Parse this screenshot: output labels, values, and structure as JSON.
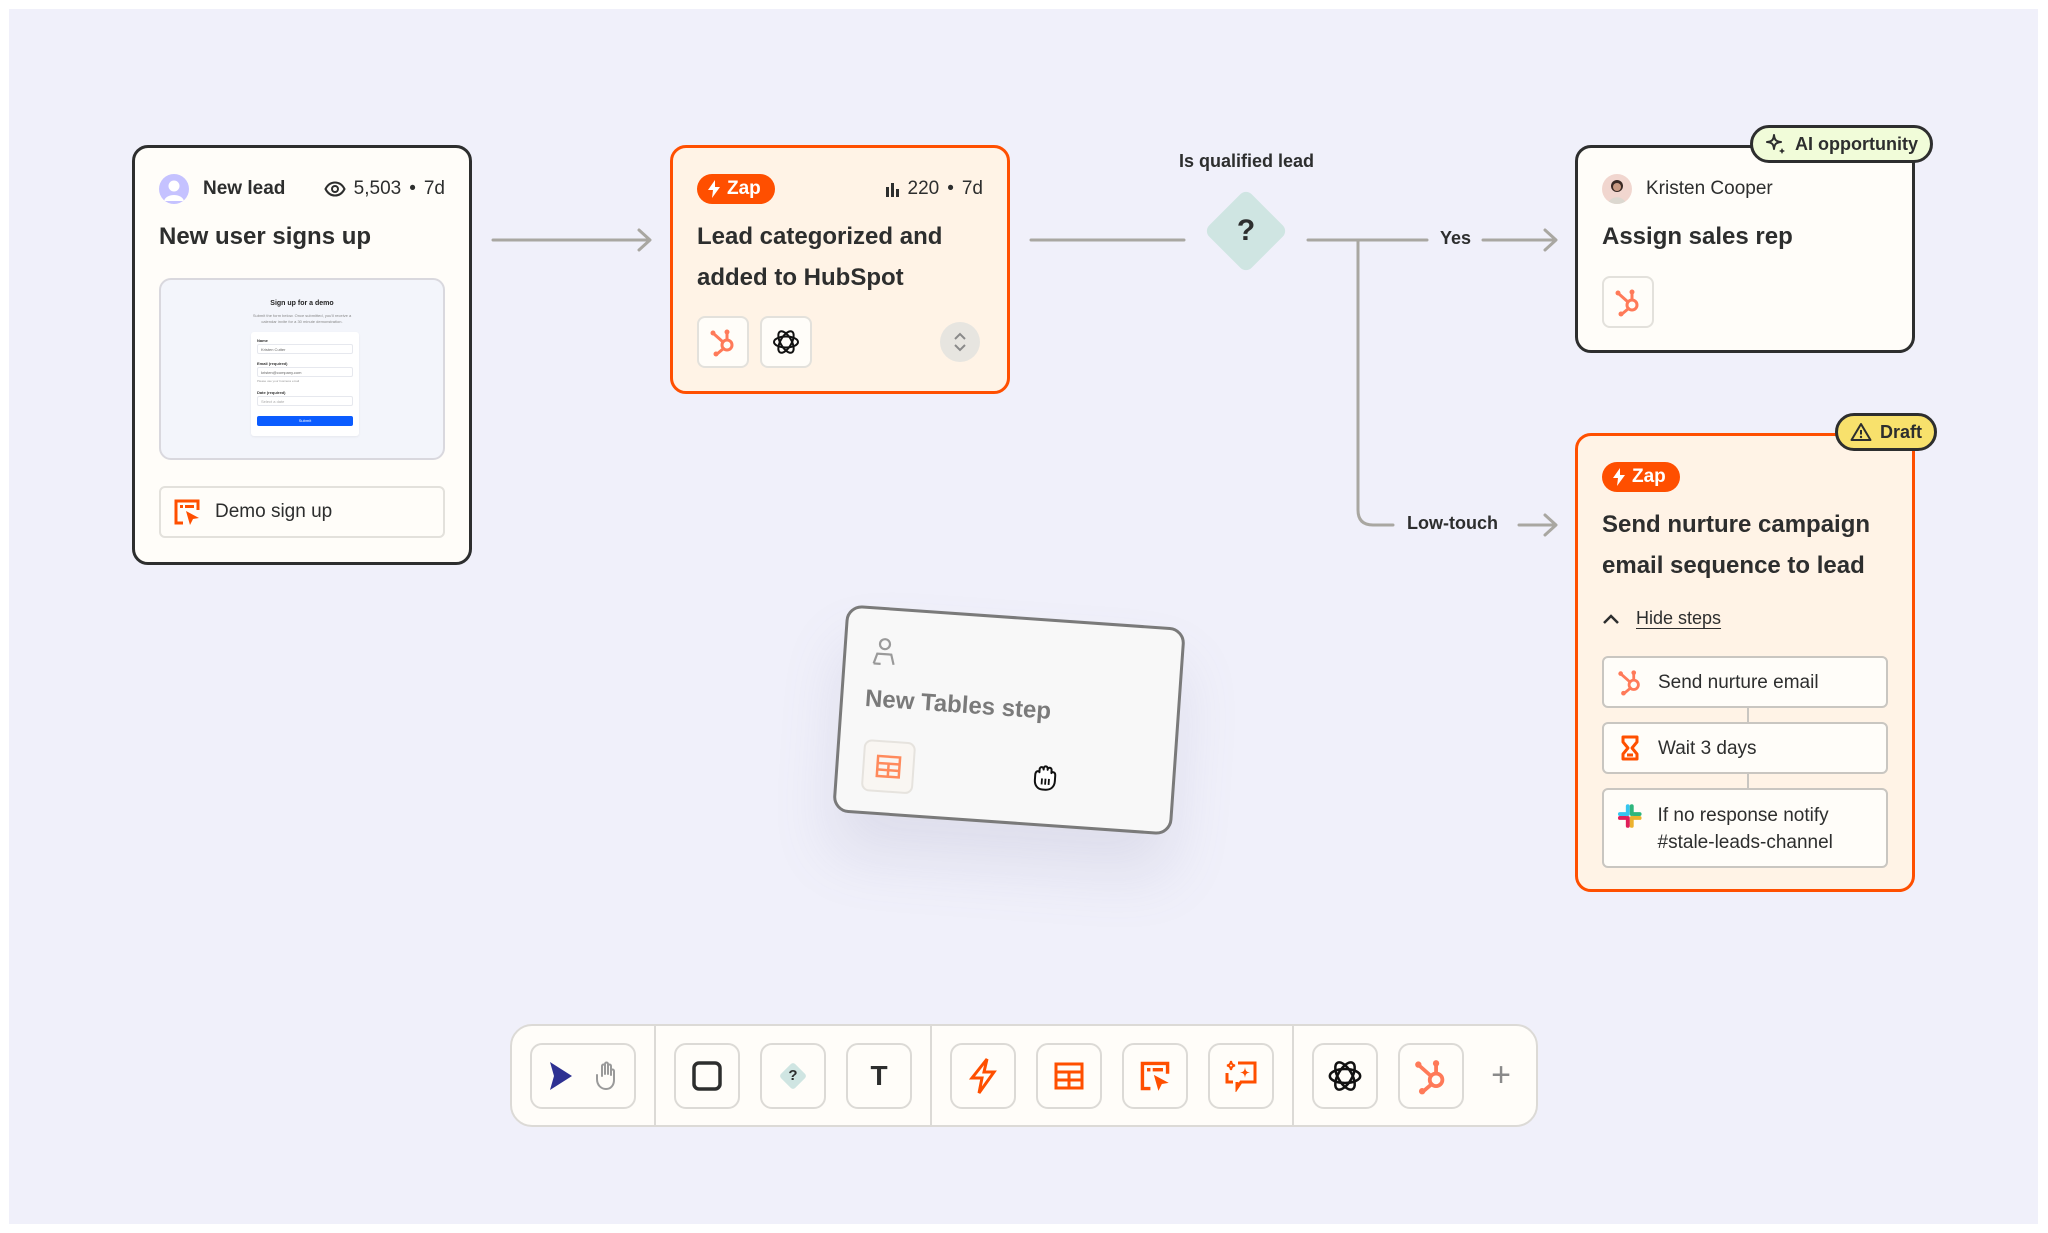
{
  "canvas": {
    "background": "#f0f0fa",
    "accent": "#ff4f00",
    "edge_color": "#a9a7a1"
  },
  "nodes": {
    "trigger": {
      "kind_label": "New lead",
      "views": "5,503",
      "period": "7d",
      "meta_separator": "•",
      "title": "New user signs up",
      "preview": {
        "heading": "Sign up for a demo",
        "subtext": "Submit the form below. Once submitted, you'll receive a calendar invite for a 30 minute demonstration.",
        "fields": [
          {
            "label": "Name",
            "value": "Kristen Cutter"
          },
          {
            "label": "Email (required)",
            "value": "kristen@company.com",
            "hint": "Please use your business email"
          },
          {
            "label": "Date (required)",
            "value": "Select a date"
          }
        ],
        "submit_label": "Submit"
      },
      "source_label": "Demo sign up"
    },
    "zap1": {
      "pill_label": "Zap",
      "runs": "220",
      "period": "7d",
      "meta_separator": "•",
      "title": "Lead categorized and added to HubSpot",
      "apps": [
        "hubspot-icon",
        "openai-icon"
      ]
    },
    "decision": {
      "label": "Is qualified lead",
      "glyph": "?",
      "branches": [
        "Yes",
        "Low-touch"
      ]
    },
    "assign": {
      "badge_label": "AI opportunity",
      "owner": "Kristen Cooper",
      "title": "Assign sales rep",
      "apps": [
        "hubspot-icon"
      ]
    },
    "nurture": {
      "badge_label": "Draft",
      "pill_label": "Zap",
      "title": "Send nurture campaign email sequence to lead",
      "toggle_label": "Hide steps",
      "steps": [
        {
          "icon": "hubspot-icon",
          "label": "Send nurture email"
        },
        {
          "icon": "hourglass-icon",
          "label": "Wait 3 days"
        },
        {
          "icon": "slack-icon",
          "label": "If no response notify #stale-leads-channel"
        }
      ]
    },
    "dragging": {
      "title": "New Tables step",
      "app": "tables-icon"
    }
  },
  "toolbar": {
    "groups": [
      [
        "select-pointer-tool",
        "hand-pan-tool"
      ],
      [
        "rectangle-tool",
        "decision-tool",
        "text-tool"
      ],
      [
        "zap-tool",
        "tables-tool",
        "interfaces-tool",
        "ai-chatbot-tool"
      ],
      [
        "openai-app",
        "hubspot-app",
        "add-app"
      ]
    ],
    "text_tool_glyph": "T",
    "decision_glyph": "?",
    "add_glyph": "+"
  }
}
